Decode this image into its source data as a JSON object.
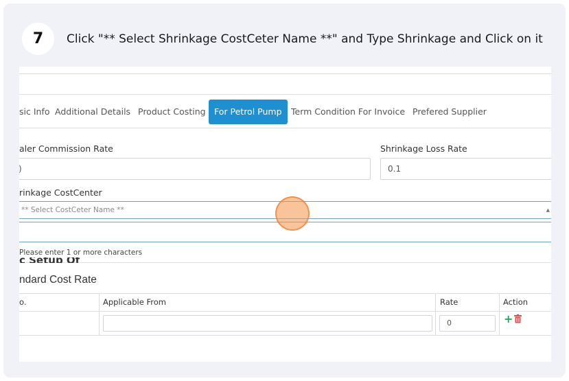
{
  "step": {
    "number": "7",
    "instruction": "Click \"** Select Shrinkage CostCeter Name **\" and Type Shrinkage and Click on it"
  },
  "tabs": [
    {
      "label": "sic Info"
    },
    {
      "label": "Additional Details"
    },
    {
      "label": "Product Costing"
    },
    {
      "label": "For Petrol Pump",
      "active": true
    },
    {
      "label": "Term Condition For Invoice"
    },
    {
      "label": "Prefered Supplier"
    }
  ],
  "form": {
    "dealer_commission_label": "aler Commission Rate",
    "dealer_commission_value": ")",
    "shrinkage_loss_label": "Shrinkage Loss Rate",
    "shrinkage_loss_value": "0.1",
    "shrinkage_costcenter_label": "rinkage CostCenter",
    "costcenter_placeholder": "** Select CostCeter Name **",
    "search_hint": "Please enter 1 or more characters"
  },
  "section": {
    "cut_heading": "c Setup Of",
    "title": "ndard Cost Rate"
  },
  "table": {
    "columns": [
      "o.",
      "Applicable From",
      "Rate",
      "Action"
    ],
    "row": {
      "applicable_from": "",
      "rate": "0"
    }
  },
  "colors": {
    "active_tab": "#1e8fd1",
    "add_icon": "#2aa56b",
    "delete_icon": "#d9534f",
    "click_marker": "#f59448"
  }
}
